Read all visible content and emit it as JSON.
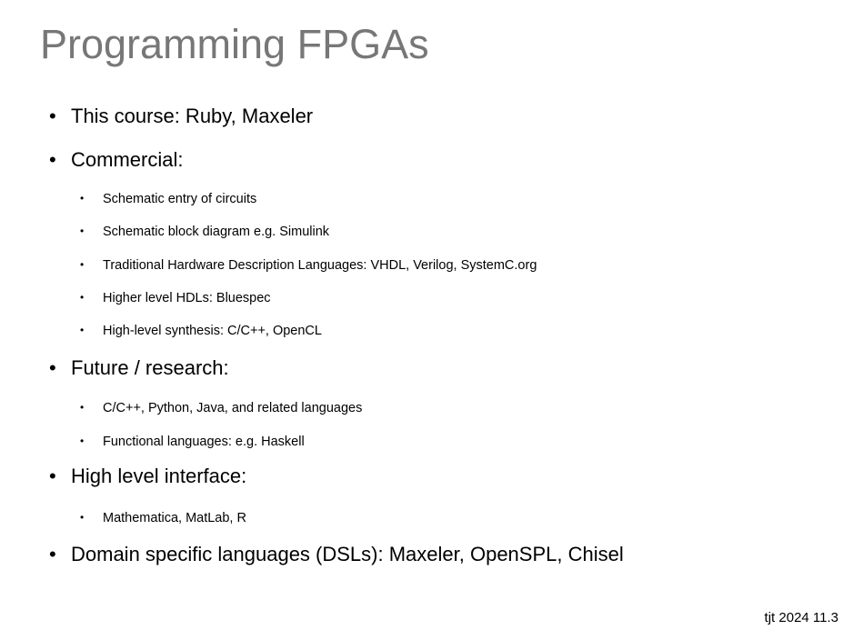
{
  "slide": {
    "title": "Programming FPGAs",
    "bullets": [
      {
        "level": 1,
        "text": "This course: Ruby, Maxeler"
      },
      {
        "level": 1,
        "text": "Commercial:"
      },
      {
        "level": 2,
        "text": "Schematic entry of circuits"
      },
      {
        "level": 2,
        "text": "Schematic block diagram e.g. Simulink"
      },
      {
        "level": 2,
        "text": "Traditional Hardware Description Languages: VHDL, Verilog, SystemC.org"
      },
      {
        "level": 2,
        "text": "Higher level HDLs: Bluespec"
      },
      {
        "level": 2,
        "text": "High-level synthesis: C/C++, OpenCL"
      },
      {
        "level": 1,
        "text": "Future / research:"
      },
      {
        "level": 2,
        "text": "C/C++, Python, Java, and related languages"
      },
      {
        "level": 2,
        "text": "Functional languages: e.g. Haskell"
      },
      {
        "level": 1,
        "text": "High level interface:"
      },
      {
        "level": 2,
        "text": "Mathematica, MatLab, R"
      },
      {
        "level": 1,
        "text": "Domain specific languages (DSLs): Maxeler, OpenSPL, Chisel"
      }
    ],
    "bullet_glyph": "•",
    "footer": "tjt 2024 11.3",
    "title_color": "#777777"
  }
}
